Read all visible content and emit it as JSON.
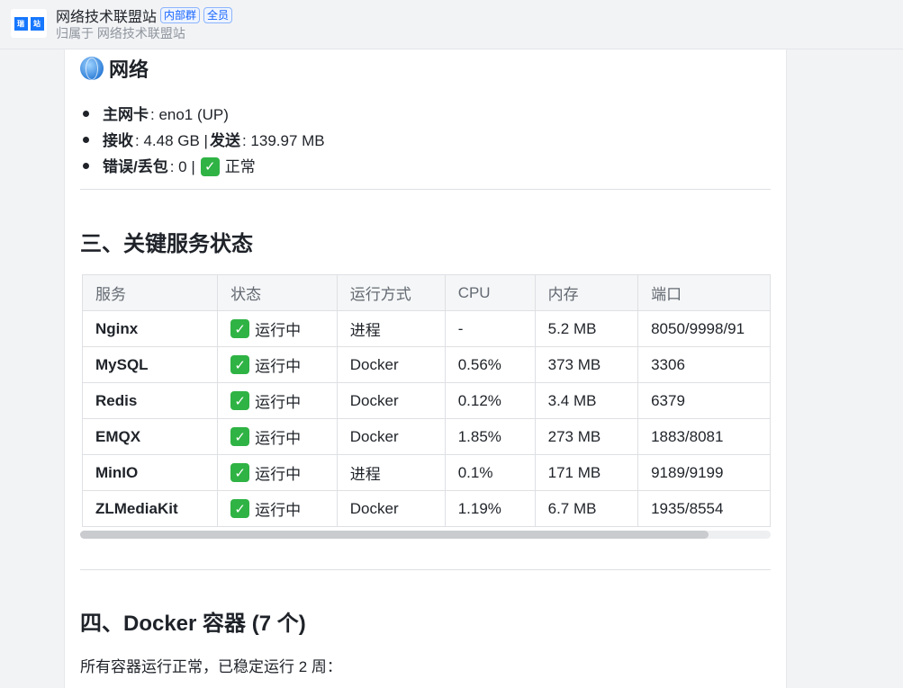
{
  "header": {
    "logo_chars": [
      "瑞",
      "站"
    ],
    "title": "网络技术联盟站",
    "tags": [
      "内部群",
      "全员"
    ],
    "subtitle": "归属于 网络技术联盟站"
  },
  "network": {
    "heading": "网络",
    "items": [
      {
        "label": "主网卡",
        "value": ": eno1 (UP)"
      },
      {
        "label": "接收",
        "value": ": 4.48 GB | ",
        "label2": "发送",
        "value2": ": 139.97 MB"
      },
      {
        "label": "错误/丢包",
        "value": ": 0 | ",
        "status": "正常"
      }
    ]
  },
  "services": {
    "heading": "三、关键服务状态",
    "columns": [
      "服务",
      "状态",
      "运行方式",
      "CPU",
      "内存",
      "端口"
    ],
    "rows": [
      {
        "name": "Nginx",
        "status": "运行中",
        "mode": "进程",
        "cpu": "-",
        "mem": "5.2 MB",
        "port": "8050/9998/91"
      },
      {
        "name": "MySQL",
        "status": "运行中",
        "mode": "Docker",
        "cpu": "0.56%",
        "mem": "373 MB",
        "port": "3306"
      },
      {
        "name": "Redis",
        "status": "运行中",
        "mode": "Docker",
        "cpu": "0.12%",
        "mem": "3.4 MB",
        "port": "6379"
      },
      {
        "name": "EMQX",
        "status": "运行中",
        "mode": "Docker",
        "cpu": "1.85%",
        "mem": "273 MB",
        "port": "1883/8081"
      },
      {
        "name": "MinIO",
        "status": "运行中",
        "mode": "进程",
        "cpu": "0.1%",
        "mem": "171 MB",
        "port": "9189/9199"
      },
      {
        "name": "ZLMediaKit",
        "status": "运行中",
        "mode": "Docker",
        "cpu": "1.19%",
        "mem": "6.7 MB",
        "port": "1935/8554"
      }
    ],
    "scroll_fraction": 0.91
  },
  "docker": {
    "heading": "四、Docker 容器 (7 个)",
    "summary": "所有容器运行正常，已稳定运行 2 周："
  },
  "icons": {
    "network": "globe-icon",
    "status_ok": "check-mark-icon"
  },
  "colors": {
    "accent": "#1664ff",
    "check": "#2fb344"
  }
}
